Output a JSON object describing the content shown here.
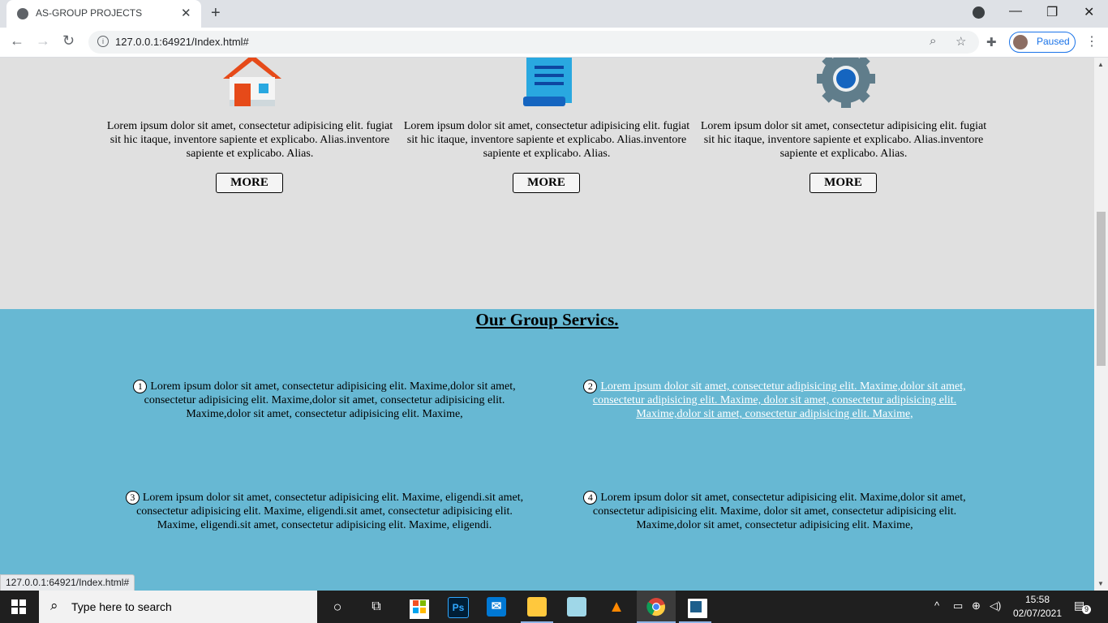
{
  "browser": {
    "tab_title": "AS-GROUP PROJECTS",
    "url": "127.0.0.1:64921/Index.html#",
    "profile_label": "Paused",
    "status_url": "127.0.0.1:64921/Index.html#"
  },
  "cards": [
    {
      "icon": "house-icon",
      "text": "Lorem ipsum dolor sit amet, consectetur adipisicing elit. fugiat sit hic itaque, inventore sapiente et explicabo. Alias.inventore sapiente et explicabo. Alias.",
      "button": "MORE"
    },
    {
      "icon": "document-scroll-icon",
      "text": "Lorem ipsum dolor sit amet, consectetur adipisicing elit. fugiat sit hic itaque, inventore sapiente et explicabo. Alias.inventore sapiente et explicabo. Alias.",
      "button": "MORE"
    },
    {
      "icon": "gear-icon",
      "text": "Lorem ipsum dolor sit amet, consectetur adipisicing elit. fugiat sit hic itaque, inventore sapiente et explicabo. Alias.inventore sapiente et explicabo. Alias.",
      "button": "MORE"
    }
  ],
  "services": {
    "title": "Our Group Servics.",
    "items": [
      {
        "num": "1",
        "text": "Lorem ipsum dolor sit amet, consectetur adipisicing elit. Maxime,dolor sit amet, consectetur adipisicing elit. Maxime,dolor sit amet, consectetur adipisicing elit. Maxime,dolor sit amet, consectetur adipisicing elit. Maxime,"
      },
      {
        "num": "2",
        "text": "Lorem ipsum dolor sit amet, consectetur adipisicing elit. Maxime,dolor sit amet, consectetur adipisicing elit. Maxime, dolor sit amet, consectetur adipisicing elit. Maxime,dolor sit amet, consectetur adipisicing elit. Maxime,"
      },
      {
        "num": "3",
        "text": "Lorem ipsum dolor sit amet, consectetur adipisicing elit. Maxime, eligendi.sit amet, consectetur adipisicing elit. Maxime, eligendi.sit amet, consectetur adipisicing elit. Maxime, eligendi.sit amet, consectetur adipisicing elit. Maxime, eligendi."
      },
      {
        "num": "4",
        "text": "Lorem ipsum dolor sit amet, consectetur adipisicing elit. Maxime,dolor sit amet, consectetur adipisicing elit. Maxime, dolor sit amet, consectetur adipisicing elit. Maxime,dolor sit amet, consectetur adipisicing elit. Maxime,"
      }
    ]
  },
  "taskbar": {
    "search_placeholder": "Type here to search",
    "time": "15:58",
    "date": "02/07/2021",
    "notification_count": "9",
    "apps": [
      "cortana-icon",
      "task-view-icon",
      "store-icon",
      "photoshop-icon",
      "mail-icon",
      "file-explorer-icon",
      "app-icon",
      "vlc-icon",
      "chrome-icon",
      "app-icon"
    ]
  }
}
